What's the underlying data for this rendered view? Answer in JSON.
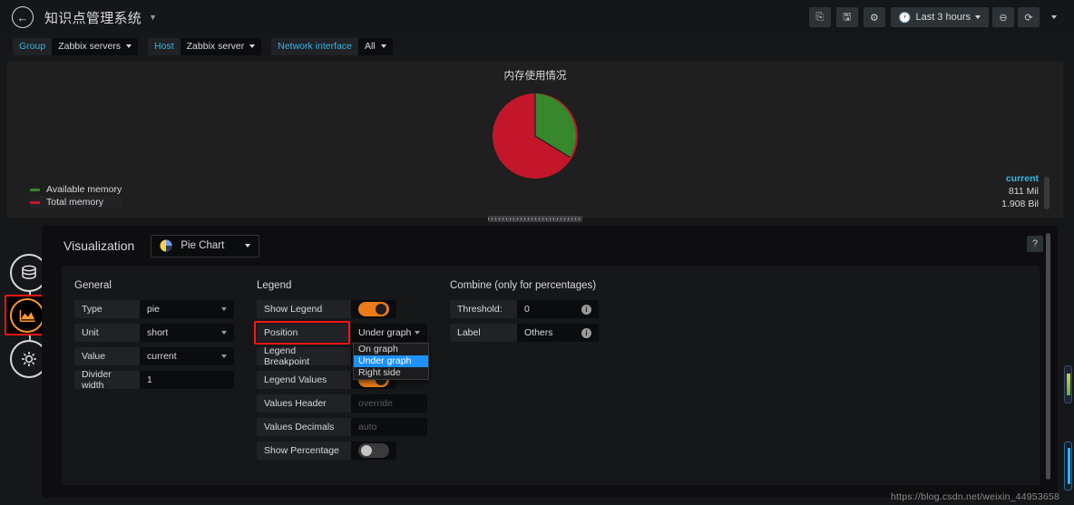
{
  "navbar": {
    "back_icon": "arrow-left-icon",
    "dashboard_title": "知识点管理系统",
    "title_caret": "chevron-down-icon",
    "actions": [
      {
        "name": "share-dashboard-button",
        "glyph": "⎘"
      },
      {
        "name": "save-dashboard-button",
        "glyph": "🖫"
      },
      {
        "name": "dashboard-settings-button",
        "glyph": "✹"
      }
    ],
    "time_range": "Last 3 hours",
    "time_icon": "clock-icon",
    "zoom_out_label": "zoom-out-icon",
    "refresh_label": "refresh-icon"
  },
  "filters": [
    {
      "label": "Group",
      "value": "Zabbix servers"
    },
    {
      "label": "Host",
      "value": "Zabbix server"
    },
    {
      "label": "Network interface",
      "value": "All"
    }
  ],
  "graph_panel": {
    "title": "内存使用情况",
    "legend_header": "current",
    "series": [
      {
        "name": "Available memory",
        "color": "#37872d",
        "value": "811 Mil"
      },
      {
        "name": "Total memory",
        "color": "#c4162a",
        "value": "1.908 Bil"
      }
    ]
  },
  "chart_data": {
    "type": "pie",
    "title": "内存使用情况",
    "labels": [
      "Available memory",
      "Total memory"
    ],
    "values": [
      811,
      1908
    ],
    "value_unit": "bytes",
    "display_values": [
      "811 Mil",
      "1.908 Bil"
    ],
    "colors": [
      "#37872d",
      "#c4162a"
    ],
    "percentages": [
      34,
      66
    ],
    "legend": [
      "Available memory",
      "Total memory"
    ],
    "legend_position": "under graph",
    "legend_values_header": "current",
    "grid": false
  },
  "rail": [
    {
      "name": "sidebar-item-query",
      "icon": "database-icon",
      "active": false
    },
    {
      "name": "sidebar-item-visualization",
      "icon": "graph-area-icon",
      "active": true
    },
    {
      "name": "sidebar-item-settings",
      "icon": "gear-bug-icon",
      "active": false
    }
  ],
  "viz": {
    "heading": "Visualization",
    "type_value": "Pie Chart",
    "type_icon": "pie-chart-icon",
    "help_label": "?",
    "general": {
      "title": "General",
      "rows": [
        {
          "label": "Type",
          "value": "pie",
          "control": "select"
        },
        {
          "label": "Unit",
          "value": "short",
          "control": "select"
        },
        {
          "label": "Value",
          "value": "current",
          "control": "select"
        },
        {
          "label": "Divider width",
          "value": "1",
          "control": "input"
        }
      ]
    },
    "legend": {
      "title": "Legend",
      "rows": [
        {
          "label": "Show Legend",
          "control": "toggle",
          "value": "on"
        },
        {
          "label": "Position",
          "control": "select",
          "value": "Under graph",
          "highlighted": true,
          "open": true
        },
        {
          "label": "Legend Breakpoint",
          "control": "input",
          "value": ""
        },
        {
          "label": "Legend Values",
          "control": "toggle",
          "value": "on"
        },
        {
          "label": "Values Header",
          "control": "input",
          "value": "",
          "placeholder": "override"
        },
        {
          "label": "Values Decimals",
          "control": "input",
          "value": "",
          "placeholder": "auto"
        },
        {
          "label": "Show Percentage",
          "control": "toggle",
          "value": "off"
        }
      ],
      "position_options": [
        "On graph",
        "Under graph",
        "Right side"
      ],
      "position_selected": "Under graph"
    },
    "combine": {
      "title": "Combine (only for percentages)",
      "rows": [
        {
          "label": "Threshold:",
          "value": "0",
          "info": "info-icon"
        },
        {
          "label": "Label",
          "value": "Others",
          "info": "info-icon"
        }
      ]
    }
  },
  "watermark": "https://blog.csdn.net/weixin_44953658"
}
